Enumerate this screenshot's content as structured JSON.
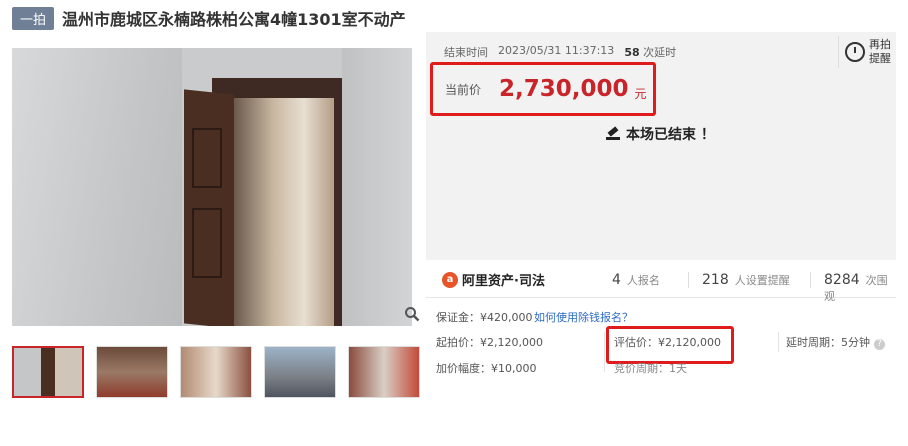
{
  "header": {
    "badge": "一拍",
    "title": "温州市鹿城区永楠路株柏公寓4幢1301室不动产"
  },
  "gallery": {
    "zoom_icon": "magnifier-icon",
    "thumbnail_count": 5
  },
  "auction": {
    "end_label": "结束时间",
    "end_time": "2023/05/31 11:37:13",
    "delay_count": "58",
    "delay_label": "次延时",
    "remind_line1": "再拍",
    "remind_line2": "提醒",
    "current_price_label": "当前价",
    "current_price": "2,730,000",
    "currency_unit": "元",
    "ended_text": "本场已结束 ！"
  },
  "stats": {
    "brand": "阿里资产·司法",
    "signup_count": "4",
    "signup_label": "人报名",
    "reminder_count": "218",
    "reminder_label": "人设置提醒",
    "view_count": "8284",
    "view_label": "次围观"
  },
  "details": {
    "deposit": "保证金：¥420,000",
    "deposit_link": "如何使用除钱报名？",
    "start_price": "起拍价：¥2,120,000",
    "eval_price": "评估价：¥2,120,000",
    "delay_period": "延时周期：5分钟",
    "increment": "加价幅度：¥10,000",
    "bid_period": "竞价周期：1天"
  },
  "colors": {
    "accent": "#c8252b",
    "highlight_box": "#e01b1b",
    "link": "#2d6cc4"
  }
}
